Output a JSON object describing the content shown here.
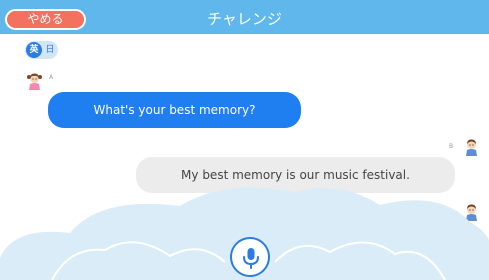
{
  "header": {
    "quit_label": "やめる",
    "title": "チャレンジ"
  },
  "language_toggle": {
    "active": "英",
    "inactive": "日"
  },
  "messages": [
    {
      "speaker": "A",
      "text": "What's your best memory?"
    },
    {
      "speaker": "B",
      "text": "My best memory is our music festival."
    },
    {
      "speaker": "B",
      "text": ""
    }
  ],
  "icons": {
    "avatar_a": "girl-avatar-icon",
    "avatar_b": "boy-avatar-icon",
    "mic": "microphone-icon"
  },
  "colors": {
    "header": "#5fb7ec",
    "quit_button": "#f2715f",
    "bubble_a": "#1f7ef0",
    "bubble_b": "#ececec",
    "clouds": "#d9ecf8",
    "mic": "#2b7be8"
  }
}
